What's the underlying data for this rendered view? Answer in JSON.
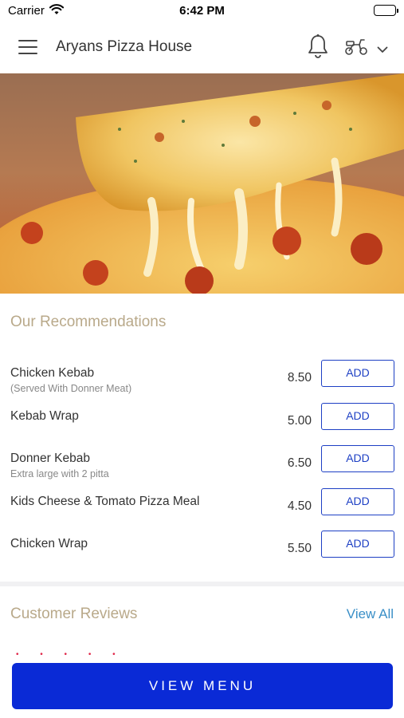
{
  "status_bar": {
    "carrier": "Carrier",
    "time": "6:42 PM"
  },
  "header": {
    "title": "Aryans Pizza House",
    "icons": [
      "hamburger-menu-icon",
      "bell-icon",
      "scooter-icon",
      "chevron-down-icon"
    ]
  },
  "hero": {
    "image": "cheese-pizza-slice"
  },
  "recommendations": {
    "title": "Our Recommendations",
    "items": [
      {
        "name": "Chicken Kebab",
        "description": "(Served With Donner Meat)",
        "price": "8.50",
        "button": "ADD"
      },
      {
        "name": "Kebab Wrap",
        "description": "",
        "price": "5.00",
        "button": "ADD"
      },
      {
        "name": "Donner Kebab",
        "description": "Extra large with 2 pitta",
        "price": "6.50",
        "button": "ADD"
      },
      {
        "name": "Kids Cheese & Tomato Pizza Meal",
        "description": "",
        "price": "4.50",
        "button": "ADD"
      },
      {
        "name": "Chicken Wrap",
        "description": "",
        "price": "5.50",
        "button": "ADD"
      }
    ]
  },
  "reviews": {
    "title": "Customer Reviews",
    "view_all": "View All",
    "stars": "• • • • •"
  },
  "footer": {
    "view_menu": "VIEW MENU"
  },
  "colors": {
    "accent": "#1d3fc4",
    "primary_button": "#0a2ad6",
    "section_title": "#b9a98a",
    "link": "#3a8fc7"
  }
}
